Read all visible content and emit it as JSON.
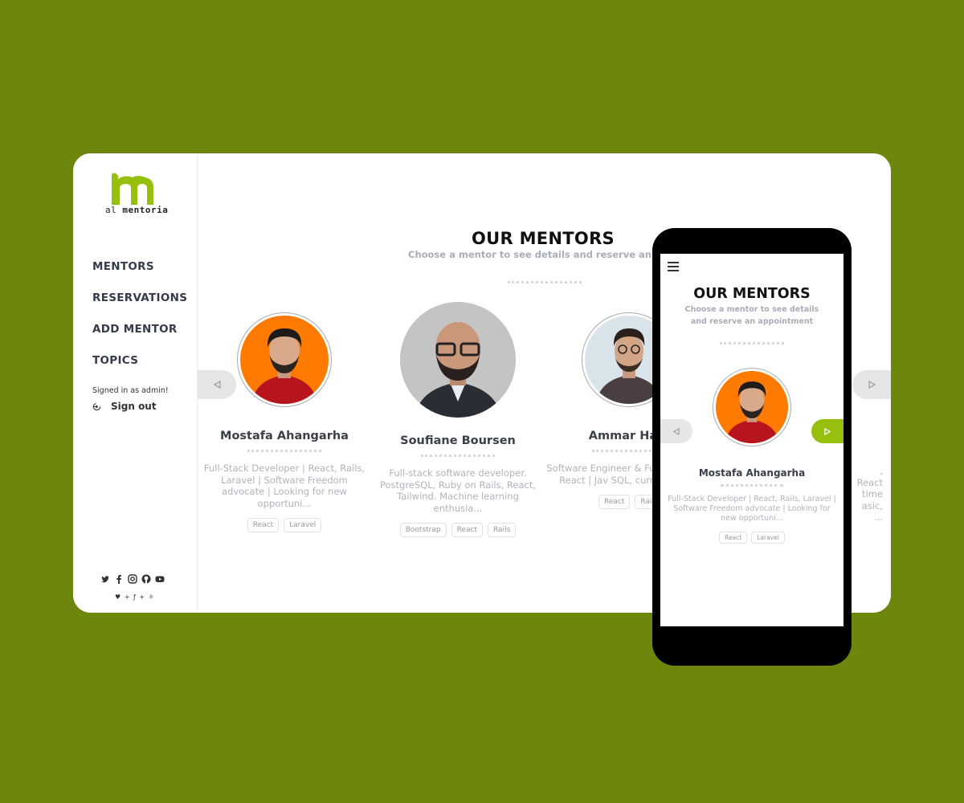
{
  "brand": {
    "logo_letter": "m",
    "logo_prefix": "al",
    "logo_name": "mentoria",
    "accent": "#97bf0d"
  },
  "sidebar": {
    "items": [
      {
        "label": "MENTORS"
      },
      {
        "label": "RESERVATIONS"
      },
      {
        "label": "ADD MENTOR"
      },
      {
        "label": "TOPICS"
      }
    ],
    "signed_in": "Signed in as admin!",
    "sign_out": "Sign out",
    "social_icons": [
      "twitter-icon",
      "facebook-icon",
      "instagram-icon",
      "github-icon",
      "youtube-icon"
    ],
    "credits": "♥ + ƒ + ⚛"
  },
  "main": {
    "title": "OUR MENTORS",
    "subtitle": "Choose a mentor to see details and reserve an appointment"
  },
  "mentors": [
    {
      "name": "Mostafa Ahangarha",
      "description": "Full-Stack Developer | React, Rails, Laravel | Software Freedom advocate | Looking for new opportuni...",
      "tags": [
        "React",
        "Laravel"
      ],
      "avatar_bg": "#ff7a00"
    },
    {
      "name": "Soufiane Boursen",
      "description": "Full-stack software developer. PostgreSQL, Ruby on Rails, React, Tailwind. Machine learning enthusia...",
      "tags": [
        "Bootstrap",
        "React",
        "Rails"
      ],
      "avatar_bg": "#bdbdbd"
    },
    {
      "name": "Ammar Ham",
      "description": "Software Engineer & Fu Developer | React | Jav SQL, currently look",
      "tags": [
        "React",
        "Rail"
      ],
      "avatar_bg": "#d9e4ea"
    }
  ],
  "offscreen_right": {
    "line1": ", React",
    "line2": "time",
    "line3": "asic, ..."
  },
  "mobile": {
    "title": "OUR MENTORS",
    "subtitle": "Choose a mentor to see details and reserve an appointment",
    "mentor": {
      "name": "Mostafa Ahangarha",
      "description": "Full-Stack Developer | React, Rails, Laravel | Software Freedom advocate | Looking for new opportuni...",
      "tags": [
        "React",
        "Laravel"
      ]
    }
  }
}
